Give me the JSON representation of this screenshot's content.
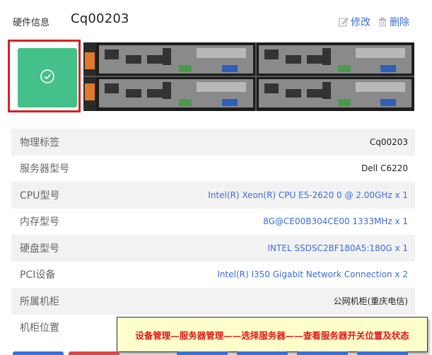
{
  "header": {
    "label": "硬件信息",
    "server_id": "Cq00203",
    "edit_label": "修改",
    "delete_label": "删除"
  },
  "status_color": "#44c08a",
  "accent_color": "#3b6ed6",
  "highlight_color": "#d62222",
  "info": [
    {
      "key": "物理标签",
      "value": "Cq00203",
      "link": false
    },
    {
      "key": "服务器型号",
      "value": "Dell C6220",
      "link": false
    },
    {
      "key": "CPU型号",
      "value": "Intel(R) Xeon(R) CPU E5-2620 0 @ 2.00GHz x 1",
      "link": true
    },
    {
      "key": "内存型号",
      "value": "8G@CE00B304CE00 1333MHz x 1",
      "link": true
    },
    {
      "key": "硬盘型号",
      "value": "INTEL SSDSC2BF180A5:180G x 1",
      "link": true
    },
    {
      "key": "PCI设备",
      "value": "Intel(R) I350 Gigabit Network Connection x 2",
      "link": true
    },
    {
      "key": "所属机柜",
      "value": "公网机柜(重庆电信)",
      "link": false
    },
    {
      "key": "机柜位置",
      "value": "",
      "link": false
    }
  ],
  "banner_text": "设备管理—服务器管理——选择服务器——查看服务器开关位置及状态"
}
